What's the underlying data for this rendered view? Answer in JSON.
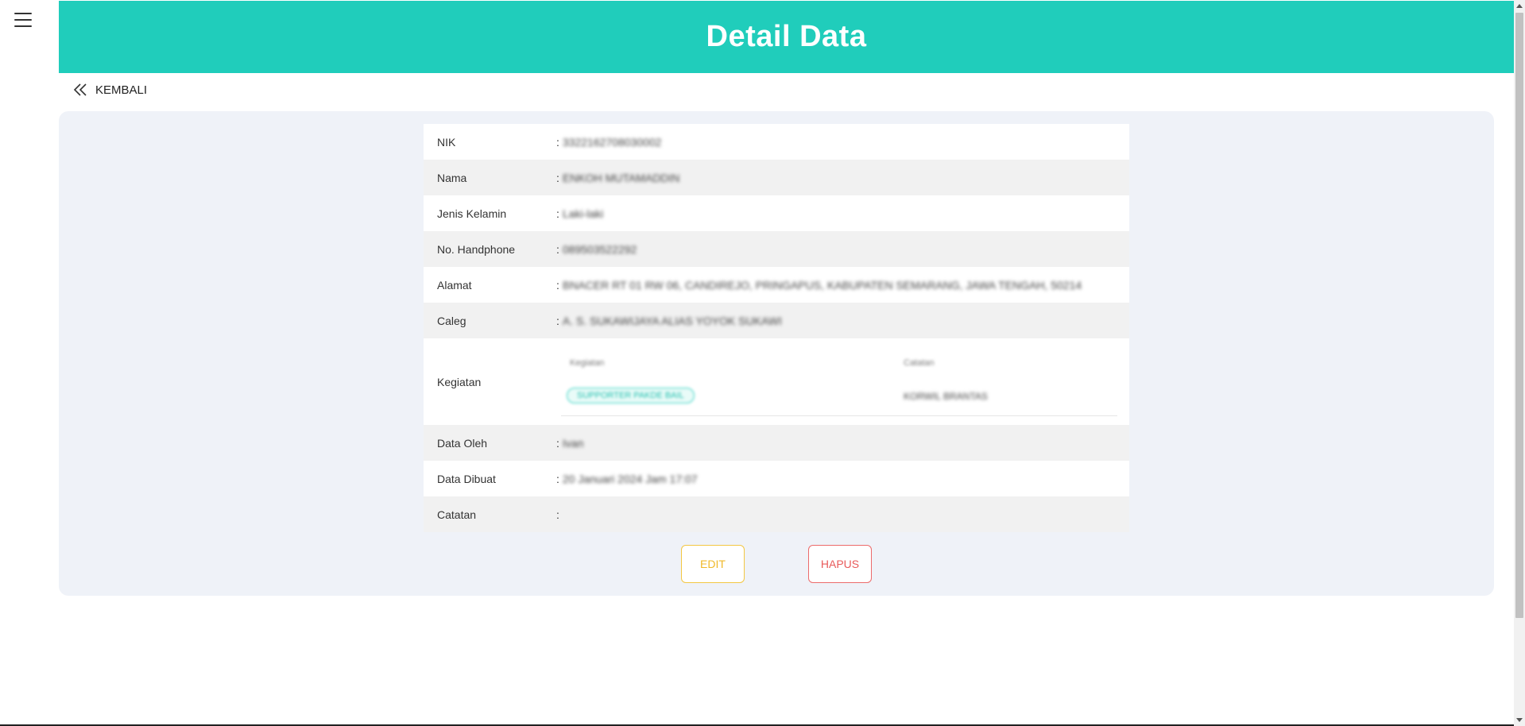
{
  "header": {
    "title": "Detail Data"
  },
  "nav": {
    "back_label": "KEMBALI"
  },
  "colors": {
    "accent": "#20cdbb",
    "panel": "#eff2f8",
    "edit": "#f0b92a",
    "hapus": "#e85a5a"
  },
  "icons": {
    "menu": "hamburger-menu-icon",
    "back": "double-chevron-left-icon"
  },
  "detail": {
    "nik": {
      "label": "NIK",
      "value": "3322162708030002"
    },
    "nama": {
      "label": "Nama",
      "value": "ENKOH MUTAMADDIN"
    },
    "jenis_kelamin": {
      "label": "Jenis Kelamin",
      "value": "Laki-laki"
    },
    "handphone": {
      "label": "No. Handphone",
      "value": "089503522292"
    },
    "alamat": {
      "label": "Alamat",
      "value": "BNACER RT 01 RW 06, CANDIREJO, PRINGAPUS, KABUPATEN SEMARANG, JAWA TENGAH, 50214"
    },
    "caleg": {
      "label": "Caleg",
      "value": "A. S. SUKAWIJAYA ALIAS YOYOK SUKAWI"
    },
    "kegiatan": {
      "label": "Kegiatan",
      "col_kegiatan": "Kegiatan",
      "col_catatan": "Catatan",
      "badge": "SUPPORTER PAKDE BAIL",
      "note": "KORWIL BRANTAS"
    },
    "data_oleh": {
      "label": "Data Oleh",
      "value": "Ivan"
    },
    "data_dibuat": {
      "label": "Data Dibuat",
      "value": "20 Januari 2024 Jam 17:07"
    },
    "catatan": {
      "label": "Catatan",
      "value": ""
    }
  },
  "actions": {
    "edit_label": "EDIT",
    "hapus_label": "HAPUS"
  }
}
